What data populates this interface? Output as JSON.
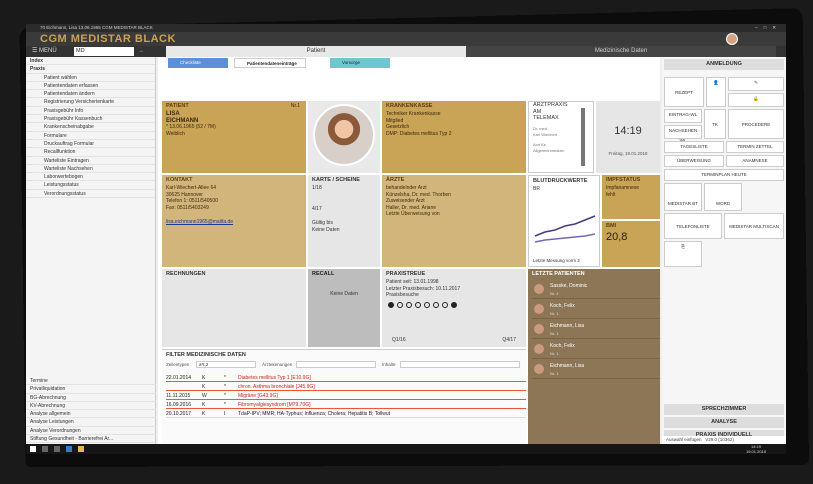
{
  "window_title": "70 Eichmann, Lisa 13.06.1965 CGM MEDISTAR BLACK",
  "app_title": "CGM MEDISTAR BLACK",
  "menu": {
    "label": "MENÜ",
    "search_value": "MD",
    "tab_patient": "Patient",
    "tab_medical": "Medizinische Daten"
  },
  "sidebar": {
    "items": [
      "Index",
      "Praxis",
      "Patient wählen",
      "Patientendaten erfassen",
      "Patientendaten ändern",
      "Registrierung Versichertenkarte",
      "Praxisgebühr Info",
      "Praxisgebühr Kassenbuch",
      "Krankenscheinabgabe",
      "Formulare",
      "Druckauftrag Formular",
      "Recallfunktion",
      "Warteliste Eintragen",
      "Warteliste Nachsehen",
      "Laborwertebogen",
      "Leistungsstatus",
      "Verordnungsstatus"
    ],
    "lower": [
      "Termine",
      "Privatliquidation",
      "BG-Abrechnung",
      "KV-Abrechnung",
      "Analyse allgemein",
      "Analyse Leistungen",
      "Analyse Verordnungen",
      "Stiftung Gesundheit - Barrierefrei Ar..."
    ]
  },
  "quickbar": {
    "b1": "Checkliste",
    "b2": "Patientendateneinträge",
    "b3": "Vorsorge"
  },
  "patient": {
    "title": "PATIENT",
    "nr": "Nr.1",
    "first": "LISA",
    "last": "EICHMANN",
    "dob": "* 13.06.1965 (52 / 7M)",
    "sex": "Weiblich"
  },
  "kasse": {
    "title": "KRANKENKASSE",
    "l1": "Techniker Krankenkasse",
    "l2": "Mitglied",
    "l3": "Gesetzlich",
    "l4": "DMP: Diabetes mellitus Typ 2"
  },
  "arzt": {
    "l1": "ARZTPRAXIS",
    "l2": "AM",
    "l3": "TELEMAX",
    "l4": "Dr. med.",
    "l5": "Karl Wiechert",
    "l6": "Arzt für",
    "l7": "Allgemeinmedizin"
  },
  "clock": {
    "time": "14:19",
    "date": "Freitag, 19.01.2018"
  },
  "kontakt": {
    "title": "KONTAKT",
    "l1": "Karl-Wiechert-Allee 64",
    "l2": "30625 Hannover",
    "l3": "Telefon 1: 0511/540500",
    "l4": "Fax: 0511/5403249",
    "mail": "lisa.eichmann1965@mailta.de"
  },
  "karte": {
    "title": "KARTE / SCHEINE",
    "q1": "1/18",
    "q2": "4/17",
    "valid": "Gültig bis",
    "none": "Keine Daten"
  },
  "aerzte": {
    "title": "ÄRZTE",
    "l1": "behandelnder Arzt",
    "l2": "Künzelsha, Dr. med. Thorben",
    "l3": "Zuweisender Arzt",
    "l4": "Haller, Dr. med. Ariane",
    "l5": "Letzte Überweisung von"
  },
  "blut": {
    "title": "BLUTDRUCKWERTE",
    "unit": "BR",
    "foot": "Letzte Messung vorm 2"
  },
  "impf": {
    "title": "IMPFSTATUS",
    "l1": "Impfanamnese",
    "l2": "fehlt"
  },
  "bmi": {
    "title": "BMI",
    "value": "20,8"
  },
  "rechnungen": {
    "title": "RECHNUNGEN"
  },
  "recall": {
    "title": "RECALL",
    "none": "Keine Daten"
  },
  "treue": {
    "title": "PRAXISTREUE",
    "l1": "Patient seit: 13.01.1998",
    "l2": "Letzter Praxisbesuch: 10.11.2017",
    "l3": "Praxisbesuche",
    "from": "Q1/16",
    "to": "Q4/17",
    "visits": [
      1,
      0,
      0,
      0,
      0,
      0,
      0,
      1
    ]
  },
  "letzte": {
    "title": "LETZTE PATIENTEN",
    "rows": [
      {
        "name": "Sasske, Dominic",
        "sub": "Nr. 4"
      },
      {
        "name": "Koch, Felix",
        "sub": "Nr. 1"
      },
      {
        "name": "Eichmann, Lisa",
        "sub": "Nr. 1"
      },
      {
        "name": "Koch, Felix",
        "sub": "Nr. 1"
      },
      {
        "name": "Eichmann, Lisa",
        "sub": "Nr. 1"
      }
    ]
  },
  "filter": {
    "title": "FILTER MEDIZINISCHE DATEN",
    "lbl1": "Zeilentypen",
    "val1": "a*t,2",
    "lbl2": "Ärztekenungen",
    "lbl3": "Inhalte",
    "rows": [
      {
        "date": "22.01.2014",
        "k": "K",
        "flag": "*",
        "text": "Diabetes mellitus Typ 1 [E10.9G]",
        "red": true
      },
      {
        "date": "",
        "k": "K",
        "flag": "*",
        "text": "chron. Asthma bronchiale [J45.9G]",
        "red": true
      },
      {
        "date": "11.11.2015",
        "k": "W",
        "flag": "*",
        "text": "Migräne [G43.9G]",
        "red": true
      },
      {
        "date": "16.09.2016",
        "k": "K",
        "flag": "*",
        "text": "Fibromyalgiesyndrom [M79.70G]",
        "red": true
      },
      {
        "date": "20.10.2017",
        "k": "K",
        "flag": "I",
        "text": "TdaP-IPV; MMR; HA-Typhus; Influenza; Cholera; Hepatitis B; Tollwut",
        "red": false
      }
    ]
  },
  "right": {
    "anmeldung": "ANMELDUNG",
    "rezept": "REZEPT",
    "eintrag": "EINTRAG-WL",
    "nachsehen": "NACHSEHEN WL",
    "tk": "TK",
    "procedere": "PROCEDERE",
    "tagesliste": "TAGESLISTE",
    "terminzettel": "TERMIN ZETTEL",
    "ueberweisung": "ÜBERWEISUNG",
    "anamnese": "ANAMNESE",
    "terminplan": "TERMINPLAN HEUTE",
    "medistar_bt": "MEDISTAR BT",
    "word": "WORD",
    "telefonliste": "TELEFONLISTE",
    "multiscan": "MEDISTAR MULTISCAN",
    "sprechzimmer": "SPRECHZIMMER",
    "analyse": "ANALYSE",
    "praxis": "PRAXIS INDIVIDUELL"
  },
  "status": {
    "text": "Auswahl einfügen",
    "ver": "V29.0 (10362)"
  },
  "taskbar": {
    "time": "14:19",
    "date": "19.01.2018"
  }
}
